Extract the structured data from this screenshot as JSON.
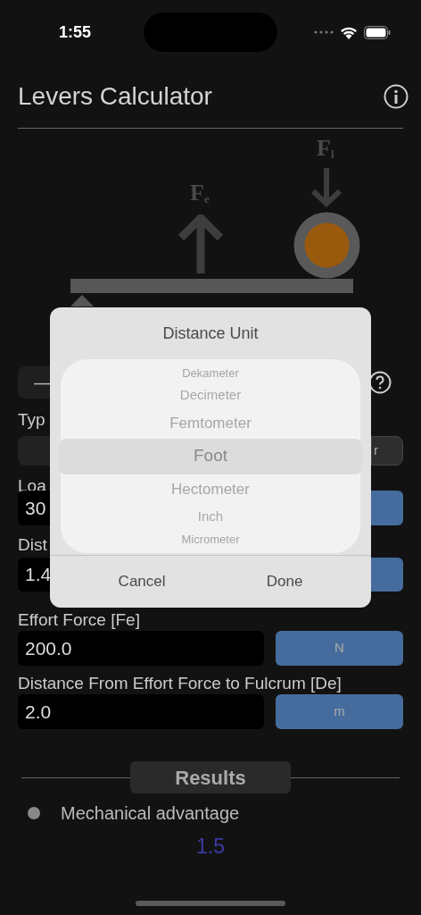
{
  "status_bar": {
    "time": "1:55"
  },
  "header": {
    "title": "Levers Calculator"
  },
  "diagram": {
    "effort_label": "F",
    "effort_sub": "e",
    "load_label": "F",
    "load_sub": "l"
  },
  "form_fragments": {
    "type_label": "Typ",
    "segment_right": "r",
    "load_label": "Loa",
    "load_value": "30",
    "distance_label": "Dist",
    "distance_value": "1.4",
    "toggle": "—"
  },
  "fields": [
    {
      "label": "Effort Force [Fe]",
      "value": "200.0",
      "unit": "N"
    },
    {
      "label": "Distance From Effort Force to Fulcrum [De]",
      "value": "2.0",
      "unit": "m"
    }
  ],
  "results": {
    "title": "Results",
    "items": [
      {
        "label": "Mechanical advantage",
        "value": "1.5"
      }
    ]
  },
  "dialog": {
    "title": "Distance Unit",
    "options": [
      {
        "label": "Dekameter",
        "selected": false
      },
      {
        "label": "Decimeter",
        "selected": false
      },
      {
        "label": "Femtometer",
        "selected": false
      },
      {
        "label": "Foot",
        "selected": true
      },
      {
        "label": "Hectometer",
        "selected": false
      },
      {
        "label": "Inch",
        "selected": false
      },
      {
        "label": "Micrometer",
        "selected": false
      }
    ],
    "buttons": [
      "Cancel",
      "Done"
    ]
  }
}
